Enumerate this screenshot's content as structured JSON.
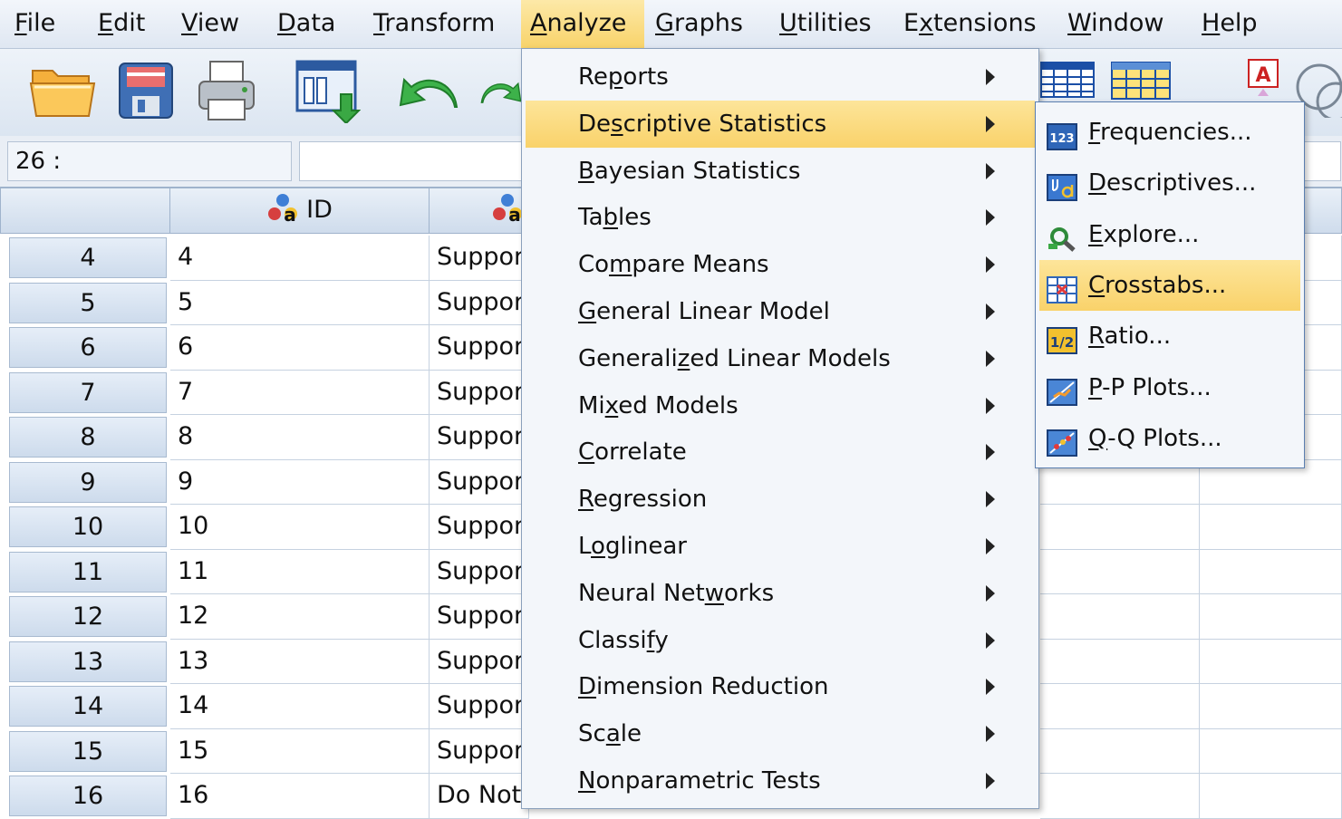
{
  "menubar": {
    "items": [
      {
        "label": "File",
        "key": "F",
        "rest": "ile"
      },
      {
        "label": "Edit",
        "key": "E",
        "rest": "dit"
      },
      {
        "label": "View",
        "key": "V",
        "rest": "iew"
      },
      {
        "label": "Data",
        "key": "D",
        "rest": "ata"
      },
      {
        "label": "Transform",
        "key": "T",
        "rest": "ransform"
      },
      {
        "label": "Analyze",
        "key": "A",
        "rest": "nalyze"
      },
      {
        "label": "Graphs",
        "key": "G",
        "rest": "raphs"
      },
      {
        "label": "Utilities",
        "key": "U",
        "rest": "tilities"
      },
      {
        "label": "Extensions",
        "pre": "E",
        "key": "x",
        "rest": "tensions"
      },
      {
        "label": "Window",
        "key": "W",
        "rest": "indow"
      },
      {
        "label": "Help",
        "key": "H",
        "rest": "elp"
      }
    ],
    "active": "Analyze"
  },
  "toolbar": {
    "icons": [
      "open-folder-icon",
      "save-icon",
      "print-icon",
      "dialog-recall-icon",
      "undo-icon",
      "redo-icon",
      "variables-grid-icon",
      "cases-grid-icon",
      "value-labels-icon",
      "sets-icon"
    ]
  },
  "editbar": {
    "cell_ref": "26 :",
    "cell_value": ""
  },
  "grid": {
    "columns": [
      {
        "name": "ID",
        "icon": "nominal-string-icon"
      },
      {
        "name": "",
        "icon": "nominal-string-icon"
      }
    ],
    "rows": [
      {
        "num": "4",
        "id": "4",
        "col2": "Suppor"
      },
      {
        "num": "5",
        "id": "5",
        "col2": "Suppor"
      },
      {
        "num": "6",
        "id": "6",
        "col2": "Suppor"
      },
      {
        "num": "7",
        "id": "7",
        "col2": "Suppor"
      },
      {
        "num": "8",
        "id": "8",
        "col2": "Suppor"
      },
      {
        "num": "9",
        "id": "9",
        "col2": "Suppor"
      },
      {
        "num": "10",
        "id": "10",
        "col2": "Suppor"
      },
      {
        "num": "11",
        "id": "11",
        "col2": "Suppor"
      },
      {
        "num": "12",
        "id": "12",
        "col2": "Suppor"
      },
      {
        "num": "13",
        "id": "13",
        "col2": "Suppor"
      },
      {
        "num": "14",
        "id": "14",
        "col2": "Suppor"
      },
      {
        "num": "15",
        "id": "15",
        "col2": "Suppor"
      },
      {
        "num": "16",
        "id": "16",
        "col2": "Do Not"
      }
    ]
  },
  "analyze_menu": {
    "items": [
      {
        "pre": "Re",
        "key": "p",
        "rest": "orts",
        "highlighted": false
      },
      {
        "pre": "De",
        "key": "s",
        "rest": "criptive Statistics",
        "highlighted": true
      },
      {
        "pre": "",
        "key": "B",
        "rest": "ayesian Statistics",
        "highlighted": false
      },
      {
        "pre": "Ta",
        "key": "b",
        "rest": "les",
        "highlighted": false
      },
      {
        "pre": "Co",
        "key": "m",
        "rest": "pare Means",
        "highlighted": false
      },
      {
        "pre": "",
        "key": "G",
        "rest": "eneral Linear Model",
        "highlighted": false
      },
      {
        "pre": "Generali",
        "key": "z",
        "rest": "ed Linear Models",
        "highlighted": false
      },
      {
        "pre": "Mi",
        "key": "x",
        "rest": "ed Models",
        "highlighted": false
      },
      {
        "pre": "",
        "key": "C",
        "rest": "orrelate",
        "highlighted": false
      },
      {
        "pre": "",
        "key": "R",
        "rest": "egression",
        "highlighted": false
      },
      {
        "pre": "L",
        "key": "o",
        "rest": "glinear",
        "highlighted": false
      },
      {
        "pre": "Neural Net",
        "key": "w",
        "rest": "orks",
        "highlighted": false
      },
      {
        "pre": "Classi",
        "key": "f",
        "rest": "y",
        "highlighted": false
      },
      {
        "pre": "",
        "key": "D",
        "rest": "imension Reduction",
        "highlighted": false
      },
      {
        "pre": "Sc",
        "key": "a",
        "rest": "le",
        "highlighted": false
      },
      {
        "pre": "",
        "key": "N",
        "rest": "onparametric Tests",
        "highlighted": false
      }
    ]
  },
  "descriptive_menu": {
    "items": [
      {
        "pre": "",
        "key": "F",
        "rest": "requencies...",
        "icon": "frequencies-icon",
        "icon_text": "123",
        "highlighted": false
      },
      {
        "pre": "",
        "key": "D",
        "rest": "escriptives...",
        "icon": "descriptives-icon",
        "icon_text": "",
        "highlighted": false
      },
      {
        "pre": "",
        "key": "E",
        "rest": "xplore...",
        "icon": "explore-icon",
        "icon_text": "",
        "highlighted": false
      },
      {
        "pre": "",
        "key": "C",
        "rest": "rosstabs...",
        "icon": "crosstabs-icon",
        "icon_text": "",
        "highlighted": true
      },
      {
        "pre": "",
        "key": "R",
        "rest": "atio...",
        "icon": "ratio-icon",
        "icon_text": "1/2",
        "highlighted": false
      },
      {
        "pre": "",
        "key": "P",
        "rest": "-P Plots...",
        "icon": "pp-plots-icon",
        "icon_text": "",
        "highlighted": false
      },
      {
        "pre": "",
        "key": "Q",
        "rest": "-Q Plots...",
        "icon": "qq-plots-icon",
        "icon_text": "",
        "highlighted": false
      }
    ]
  },
  "colors": {
    "highlight": "#f9d26a",
    "menu_bg": "#f3f6fa",
    "header_bg": "#cfdcec",
    "grid_line": "#c6d2e0"
  }
}
